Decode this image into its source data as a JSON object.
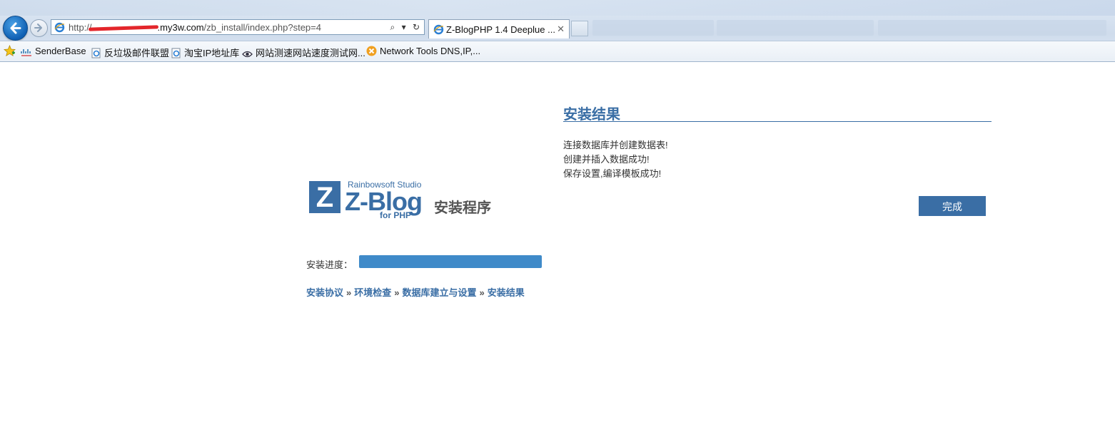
{
  "browser": {
    "url_prefix": "http://",
    "url_domain": ".my3w.com",
    "url_path": "/zb_install/index.php?step=4",
    "tab_title": "Z-BlogPHP 1.4 Deeplue ...",
    "tab_close": "✕",
    "address_tools": [
      "⌕",
      "▾",
      "↻"
    ]
  },
  "favorites": [
    {
      "label": "SenderBase",
      "icon": "cisco-icon"
    },
    {
      "label": "反垃圾邮件联盟",
      "icon": "ie-page-icon"
    },
    {
      "label": "淘宝IP地址库",
      "icon": "ie-page-icon"
    },
    {
      "label": "网站测速网站速度测试网...",
      "icon": "eye-icon"
    },
    {
      "label": "Network Tools DNS,IP,...",
      "icon": "network-tools-icon"
    }
  ],
  "result": {
    "title": "安装结果",
    "lines": [
      "连接数据库并创建数据表!",
      "创建并插入数据成功!",
      "保存设置,编译模板成功!"
    ],
    "finish_label": "完成"
  },
  "logo": {
    "z_letter": "Z",
    "studio": "Rainbowsoft Studio",
    "name": "Z-Blog",
    "for_php": "for PHP",
    "installer": "安装程序"
  },
  "progress": {
    "label": "安装进度：",
    "fraction": 1.0
  },
  "steps": {
    "items": [
      "安装协议",
      "环境检查",
      "数据库建立与设置",
      "安装结果"
    ],
    "separator": "»"
  },
  "colors": {
    "accent": "#3a6ea5",
    "progress": "#3f8ac9"
  }
}
